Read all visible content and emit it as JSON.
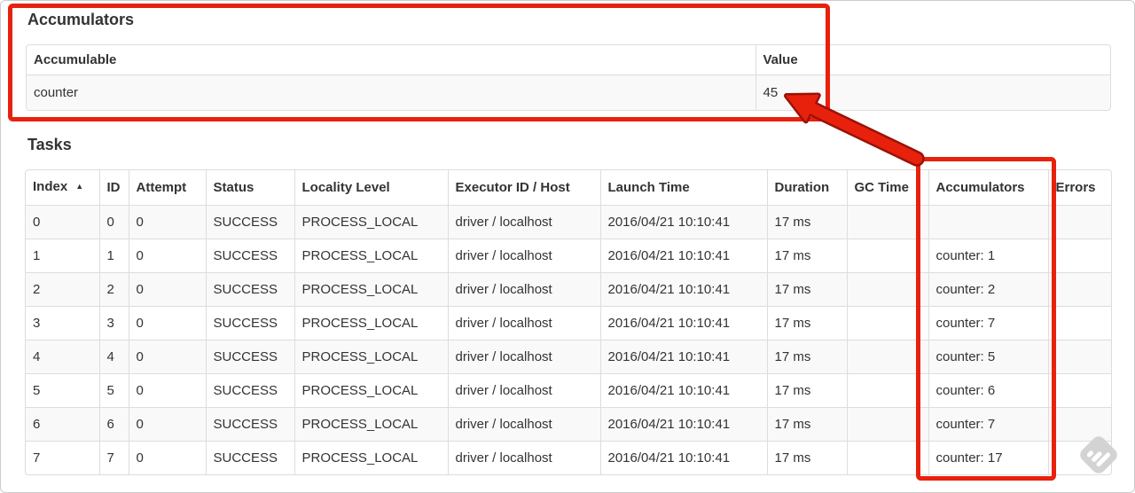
{
  "accumulators": {
    "title": "Accumulators",
    "headers": {
      "accumulable": "Accumulable",
      "value": "Value"
    },
    "rows": [
      {
        "accumulable": "counter",
        "value": "45"
      }
    ]
  },
  "tasks": {
    "title": "Tasks",
    "sort_indicator": "▲",
    "headers": {
      "index": "Index",
      "id": "ID",
      "attempt": "Attempt",
      "status": "Status",
      "locality_level": "Locality Level",
      "executor_id_host": "Executor ID / Host",
      "launch_time": "Launch Time",
      "duration": "Duration",
      "gc_time": "GC Time",
      "accumulators": "Accumulators",
      "errors": "Errors"
    },
    "rows": [
      {
        "index": "0",
        "id": "0",
        "attempt": "0",
        "status": "SUCCESS",
        "locality_level": "PROCESS_LOCAL",
        "executor_id_host": "driver / localhost",
        "launch_time": "2016/04/21 10:10:41",
        "duration": "17 ms",
        "gc_time": "",
        "accumulators": "",
        "errors": ""
      },
      {
        "index": "1",
        "id": "1",
        "attempt": "0",
        "status": "SUCCESS",
        "locality_level": "PROCESS_LOCAL",
        "executor_id_host": "driver / localhost",
        "launch_time": "2016/04/21 10:10:41",
        "duration": "17 ms",
        "gc_time": "",
        "accumulators": "counter: 1",
        "errors": ""
      },
      {
        "index": "2",
        "id": "2",
        "attempt": "0",
        "status": "SUCCESS",
        "locality_level": "PROCESS_LOCAL",
        "executor_id_host": "driver / localhost",
        "launch_time": "2016/04/21 10:10:41",
        "duration": "17 ms",
        "gc_time": "",
        "accumulators": "counter: 2",
        "errors": ""
      },
      {
        "index": "3",
        "id": "3",
        "attempt": "0",
        "status": "SUCCESS",
        "locality_level": "PROCESS_LOCAL",
        "executor_id_host": "driver / localhost",
        "launch_time": "2016/04/21 10:10:41",
        "duration": "17 ms",
        "gc_time": "",
        "accumulators": "counter: 7",
        "errors": ""
      },
      {
        "index": "4",
        "id": "4",
        "attempt": "0",
        "status": "SUCCESS",
        "locality_level": "PROCESS_LOCAL",
        "executor_id_host": "driver / localhost",
        "launch_time": "2016/04/21 10:10:41",
        "duration": "17 ms",
        "gc_time": "",
        "accumulators": "counter: 5",
        "errors": ""
      },
      {
        "index": "5",
        "id": "5",
        "attempt": "0",
        "status": "SUCCESS",
        "locality_level": "PROCESS_LOCAL",
        "executor_id_host": "driver / localhost",
        "launch_time": "2016/04/21 10:10:41",
        "duration": "17 ms",
        "gc_time": "",
        "accumulators": "counter: 6",
        "errors": ""
      },
      {
        "index": "6",
        "id": "6",
        "attempt": "0",
        "status": "SUCCESS",
        "locality_level": "PROCESS_LOCAL",
        "executor_id_host": "driver / localhost",
        "launch_time": "2016/04/21 10:10:41",
        "duration": "17 ms",
        "gc_time": "",
        "accumulators": "counter: 7",
        "errors": ""
      },
      {
        "index": "7",
        "id": "7",
        "attempt": "0",
        "status": "SUCCESS",
        "locality_level": "PROCESS_LOCAL",
        "executor_id_host": "driver / localhost",
        "launch_time": "2016/04/21 10:10:41",
        "duration": "17 ms",
        "gc_time": "",
        "accumulators": "counter: 17",
        "errors": ""
      }
    ]
  },
  "annotations": {
    "highlight_color": "#e8210d",
    "arrow_outline_color": "#9a1207"
  },
  "watermark": {
    "name": "feedly-icon",
    "color": "#d3d3d3"
  }
}
